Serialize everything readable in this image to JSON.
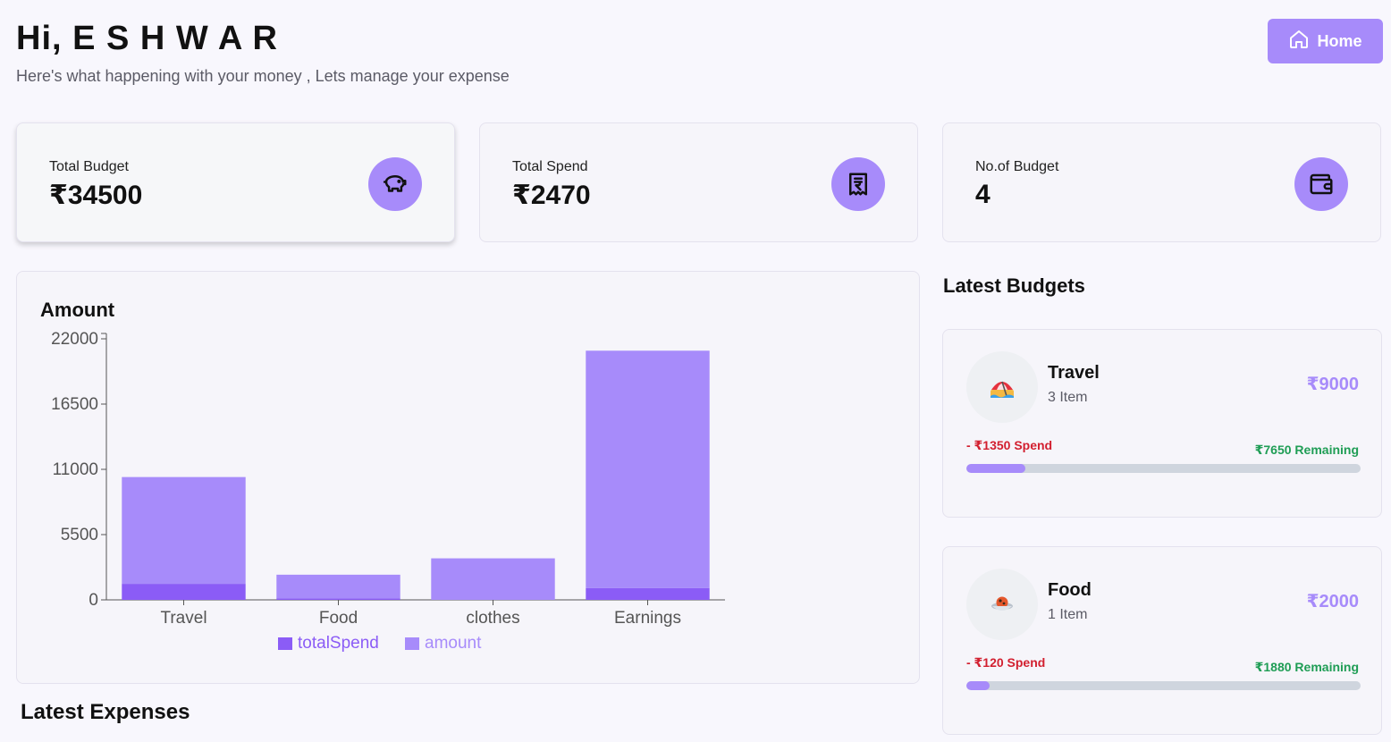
{
  "header": {
    "greeting": "Hi, E S H W A R",
    "subtitle": "Here's what happening with your money , Lets manage your expense",
    "home_button": "Home",
    "home_icon": "home-icon"
  },
  "stats": [
    {
      "label": "Total Budget",
      "value": "₹34500",
      "icon": "piggy-bank-icon"
    },
    {
      "label": "Total Spend",
      "value": "₹2470",
      "icon": "receipt-rupee-icon"
    },
    {
      "label": "No.of Budget",
      "value": "4",
      "icon": "wallet-icon"
    }
  ],
  "colors": {
    "accent": "#a78bfa",
    "accent_dark": "#8b5cf6",
    "spend_red": "#d21f2f",
    "remaining_green": "#1f9d55"
  },
  "chart_data": {
    "type": "bar",
    "stacked": true,
    "title": "Amount",
    "categories": [
      "Travel",
      "Food",
      "clothes",
      "Earnings"
    ],
    "series": [
      {
        "name": "totalSpend",
        "color": "#8b5cf6",
        "values": [
          1350,
          120,
          0,
          1000
        ]
      },
      {
        "name": "amount",
        "color": "#a78bfa",
        "values": [
          9000,
          2000,
          3500,
          20000
        ]
      }
    ],
    "yticks": [
      0,
      5500,
      11000,
      16500,
      22000
    ],
    "ylim": [
      0,
      22000
    ],
    "legend": "bottom"
  },
  "latest_budgets": {
    "title": "Latest Budgets",
    "items": [
      {
        "name": "Travel",
        "items": "3 Item",
        "amount": "₹9000",
        "spend": "- ₹1350 Spend",
        "remaining": "₹7650 Remaining",
        "progress": 0.15,
        "emoji": "🏖️"
      },
      {
        "name": "Food",
        "items": "1 Item",
        "amount": "₹2000",
        "spend": "- ₹120 Spend",
        "remaining": "₹1880 Remaining",
        "progress": 0.06,
        "emoji": "🍲"
      }
    ]
  },
  "latest_expenses": {
    "title": "Latest Expenses"
  }
}
